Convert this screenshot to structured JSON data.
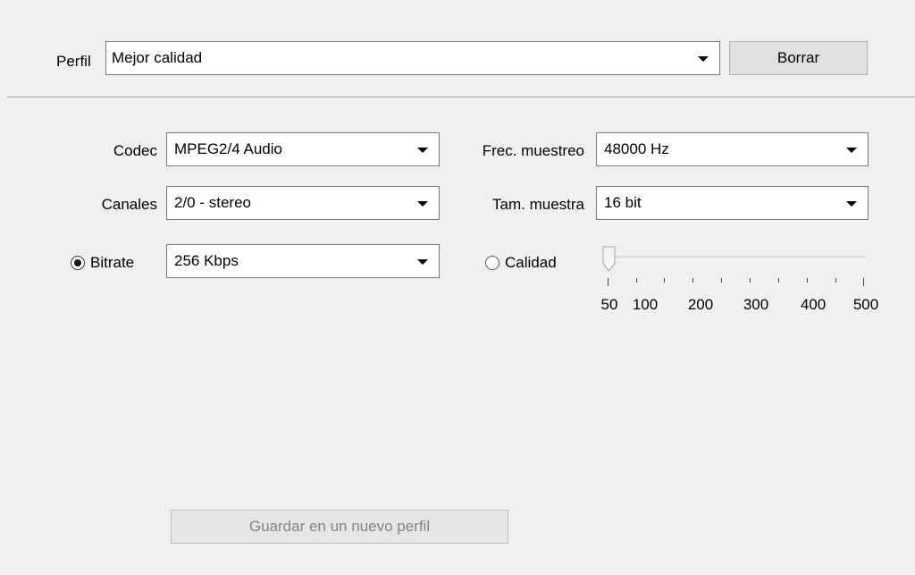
{
  "profile": {
    "label": "Perfil",
    "selected": "Mejor calidad",
    "delete_button": "Borrar"
  },
  "codec": {
    "label": "Codec",
    "selected": "MPEG2/4 Audio"
  },
  "channels": {
    "label": "Canales",
    "selected": "2/0 - stereo"
  },
  "bitrate": {
    "label": "Bitrate",
    "selected": "256 Kbps",
    "checked": true
  },
  "sample_rate": {
    "label": "Frec. muestreo",
    "selected": "48000 Hz"
  },
  "sample_size": {
    "label": "Tam. muestra",
    "selected": "16 bit"
  },
  "quality": {
    "label": "Calidad",
    "checked": false,
    "slider_value": 50,
    "tick_labels": [
      "50",
      "100",
      "200",
      "300",
      "400",
      "500"
    ]
  },
  "save_new_profile_button": "Guardar en un nuevo perfil"
}
